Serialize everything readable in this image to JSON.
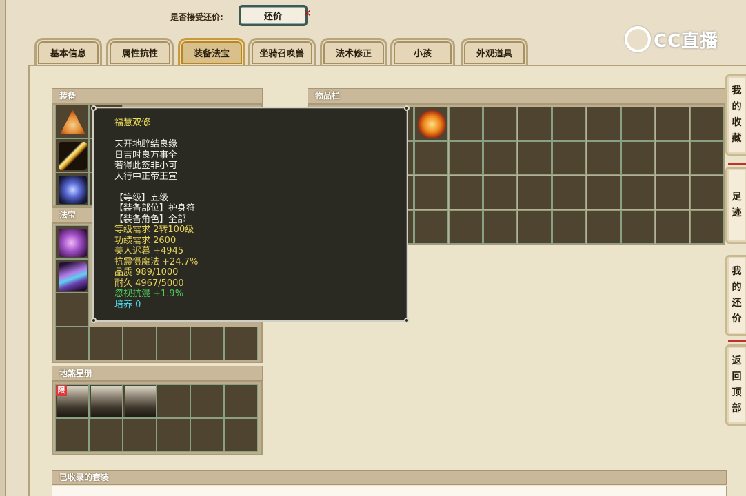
{
  "top_bar": {
    "offer_question": "是否接受还价:",
    "offer_button": "还价",
    "logo_text": "CC直播"
  },
  "tabs": [
    {
      "label": "基本信息",
      "active": false
    },
    {
      "label": "属性抗性",
      "active": false
    },
    {
      "label": "装备法宝",
      "active": true
    },
    {
      "label": "坐骑召唤兽",
      "active": false
    },
    {
      "label": "法术修正",
      "active": false
    },
    {
      "label": "小孩",
      "active": false
    },
    {
      "label": "外观道具",
      "active": false
    }
  ],
  "sections": {
    "equipment": "装备",
    "treasure": "法宝",
    "star_book": "地煞星册",
    "inventory": "物品栏",
    "collected_sets": "已收录的套装"
  },
  "star_book": {
    "limit_badge": "限"
  },
  "tooltip": {
    "title": "福慧双修",
    "poem": [
      "天开地辟结良缘",
      "日吉时良万事全",
      "若得此签非小可",
      "人行中正帝王宣"
    ],
    "info": [
      "【等级】五级",
      "【装备部位】护身符",
      "【装备角色】全部"
    ],
    "stats": [
      {
        "text": "等级需求 2转100级",
        "color": "yellow"
      },
      {
        "text": "功绩需求 2600",
        "color": "yellow"
      },
      {
        "text": "美人迟暮 +4945",
        "color": "yellow"
      },
      {
        "text": "抗震慑魔法 +24.7%",
        "color": "yellow"
      },
      {
        "text": "品质 989/1000",
        "color": "yellow"
      },
      {
        "text": "耐久 4967/5000",
        "color": "yellow"
      },
      {
        "text": "忽视抗混 +1.9%",
        "color": "green"
      },
      {
        "text": "培养 0",
        "color": "cyan"
      }
    ]
  },
  "side_buttons": [
    {
      "label": "我的收藏",
      "chars": [
        "我",
        "的",
        "收",
        "藏"
      ]
    },
    {
      "label": "足迹",
      "chars": [
        "足",
        "迹"
      ]
    },
    {
      "label": "我的还价",
      "chars": [
        "我",
        "的",
        "还",
        "价"
      ]
    },
    {
      "label": "返回顶部",
      "chars": [
        "返",
        "回",
        "顶",
        "部"
      ]
    }
  ],
  "icons": {
    "equipment_items": [
      "amulet-icon",
      "sword-icon",
      "blue-spirit-icon"
    ],
    "treasure_items": [
      "purple-ornament-icon",
      "purple-scroll-icon"
    ],
    "inventory_items": [
      "fire-orb-icon"
    ],
    "star_book_items": [
      "warrior-card-icon",
      "warrior-card-icon",
      "warrior-card-icon"
    ]
  }
}
